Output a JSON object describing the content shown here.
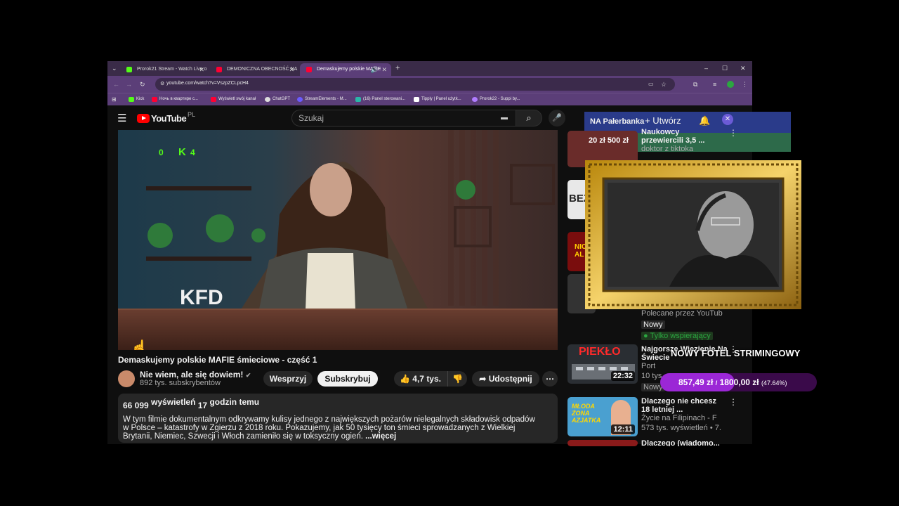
{
  "browser": {
    "tabs": [
      {
        "title": "Prorok21 Stream - Watch Live o",
        "favicon_color": "#53fc18"
      },
      {
        "title": "DEMONICZNA OBECNOŚĆ NA",
        "favicon_color": "#ff0033"
      },
      {
        "title": "Demaskujemy polskie MAFIE",
        "favicon_color": "#ff0033",
        "active": true
      }
    ],
    "new_tab": "+",
    "window_controls": [
      "–",
      "☐",
      "✕"
    ],
    "url": "youtube.com/watch?v=VszpZCLpcH4",
    "bookmarks": [
      {
        "label": "Kick",
        "color": "#53fc18"
      },
      {
        "label": "Ночь в квартире с...",
        "color": "#ff0033"
      },
      {
        "label": "Wyświetl swój kanał",
        "color": "#ff0033"
      },
      {
        "label": "ChatGPT",
        "color": "#dddddd"
      },
      {
        "label": "StreamElements - M...",
        "color": "#6b5bff"
      },
      {
        "label": "(16) Panel sterowani...",
        "color": "#2bb5a8"
      },
      {
        "label": "Tipply | Panel użytk...",
        "color": "#ffffff"
      },
      {
        "label": "Prorok22 - Suppi by...",
        "color": "#b07cff"
      }
    ]
  },
  "youtube": {
    "logo": "YouTube",
    "region": "PL",
    "search_placeholder": "Szukaj",
    "video_watermark": "KFD",
    "kick_counter": "4",
    "left_counter": "0",
    "video_title": "Demaskujemy polskie MAFIE śmieciowe - część 1",
    "channel_name": "Nie wiem, ale się dowiem!",
    "subscribers": "892 tys. subskrybentów",
    "support_label": "Wesprzyj",
    "subscribe_label": "Subskrybuj",
    "likes": "4,7 tys.",
    "share_label": "Udostępnij",
    "views": "66 099",
    "views_label": "wyświetleń",
    "time_num": "17",
    "time_label": "godzin temu",
    "description": "W tym filmie dokumentalnym odkrywamy kulisy jednego z największych pożarów nielegalnych składowisk odpadów w Polsce – katastrofy w Zgierzu z 2018 roku. Pokazujemy, jak 50 tysięcy ton śmieci sprowadzanych z Wielkiej Brytanii, Niemiec, Szwecji i Włoch zamieniło się w toksyczny ogień.",
    "more_label": "...więcej"
  },
  "header_overlay": {
    "user_label": "NA Pałerbanka",
    "create_label": "+ Utwórz"
  },
  "sidebar": [
    {
      "title": "Naukowcy przewiercili 3,5 ...",
      "meta": "doktor z tiktoka",
      "donation": "20 zł 500 zł"
    },
    {
      "title": "",
      "meta": ""
    },
    {
      "title": "",
      "meta": ""
    },
    {
      "title": "",
      "meta": "Polecane przez YouTub",
      "badge": "Nowy",
      "members": "Tylko wspierający"
    },
    {
      "title": "Najgorsze Więzienie Na Świecie",
      "meta": "Port",
      "meta2": "10 tys",
      "badge": "Nowy",
      "duration": "22:32",
      "thumb_text": "PIEKŁO"
    },
    {
      "title": "Dlaczego nie chcesz 18 letniej ...",
      "meta": "Życie na Filipinach - F",
      "meta2": "573 tys. wyświetleń • 7.",
      "duration": "12:11",
      "thumb_text": "MŁODA ŻONA AZJATKA"
    },
    {
      "title": "Dlaczego (wiadomo...",
      "meta": ""
    }
  ],
  "overlays": {
    "title_text": "NOWY FOTEL STRIMINGOWY",
    "goal_current": "857,49 zł",
    "goal_target": "1800,00 zł",
    "goal_percent": "(47.64%)",
    "goal_fraction": 0.4764
  },
  "colors": {
    "yt_red": "#ff0000",
    "tab_bar": "#3a2b48",
    "toolbar": "#5b3e78",
    "goal_fill": "#9b27d6",
    "members_green": "#2ba640"
  }
}
